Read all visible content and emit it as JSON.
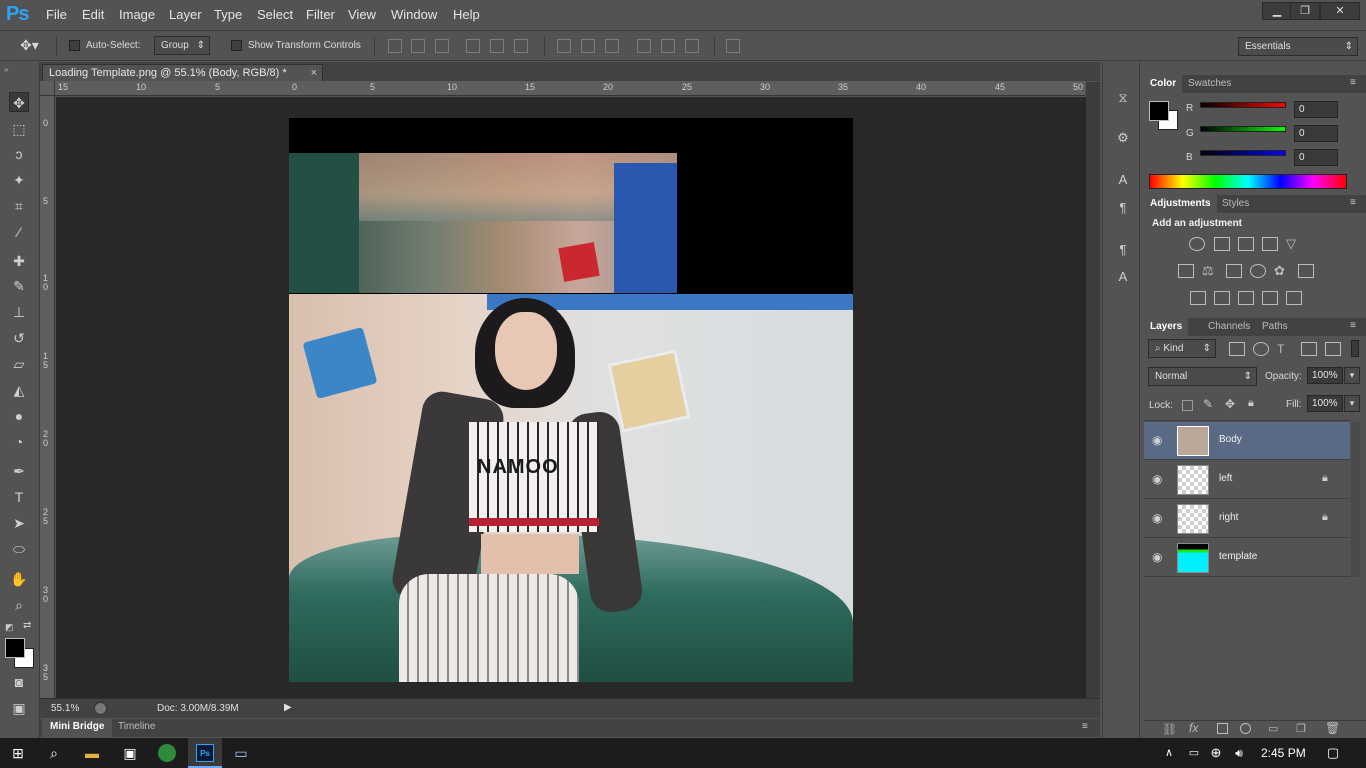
{
  "app": {
    "logo": "Ps",
    "colors": {
      "accent": "#2fa3f5",
      "selected_layer": "#5a6a85"
    }
  },
  "menu": [
    "File",
    "Edit",
    "Image",
    "Layer",
    "Type",
    "Select",
    "Filter",
    "View",
    "Window",
    "Help"
  ],
  "window_controls": {
    "min_icon": "minimize-icon",
    "restore_icon": "restore-icon",
    "close_icon": "close-icon"
  },
  "options_bar": {
    "auto_select_label": "Auto-Select:",
    "auto_select_value": "Group",
    "show_transform_label": "Show Transform Controls",
    "workspace": "Essentials"
  },
  "document": {
    "tab_title": "Loading Template.png @ 55.1% (Body, RGB/8) *",
    "close": "×",
    "zoom": "55.1%",
    "doc_size": "Doc: 3.00M/8.39M",
    "ruler_top": [
      "15",
      "10",
      "5",
      "0",
      "5",
      "10",
      "15",
      "20",
      "25",
      "30",
      "35",
      "40",
      "45",
      "50"
    ],
    "ruler_left": [
      "0",
      "5",
      "1 0",
      "1 5",
      "2 0",
      "2 5",
      "3 0",
      "3 5"
    ],
    "image_text": "NAMOO"
  },
  "bottom_tabs": [
    "Mini Bridge",
    "Timeline"
  ],
  "color_panel": {
    "tabs": [
      "Color",
      "Swatches"
    ],
    "channels": [
      {
        "label": "R",
        "value": "0"
      },
      {
        "label": "G",
        "value": "0"
      },
      {
        "label": "B",
        "value": "0"
      }
    ]
  },
  "adjustments_panel": {
    "tabs": [
      "Adjustments",
      "Styles"
    ],
    "heading": "Add an adjustment"
  },
  "layers_panel": {
    "tabs": [
      "Layers",
      "Channels",
      "Paths"
    ],
    "filter_kind": "Kind",
    "blend_mode": "Normal",
    "opacity_label": "Opacity:",
    "opacity_value": "100%",
    "lock_label": "Lock:",
    "fill_label": "Fill:",
    "fill_value": "100%",
    "layers": [
      {
        "name": "Body",
        "selected": true,
        "locked": false
      },
      {
        "name": "left",
        "selected": false,
        "locked": true
      },
      {
        "name": "right",
        "selected": false,
        "locked": true
      },
      {
        "name": "template",
        "selected": false,
        "locked": false
      }
    ]
  },
  "taskbar": {
    "time": "2:45 PM",
    "ps_label": "Ps"
  }
}
